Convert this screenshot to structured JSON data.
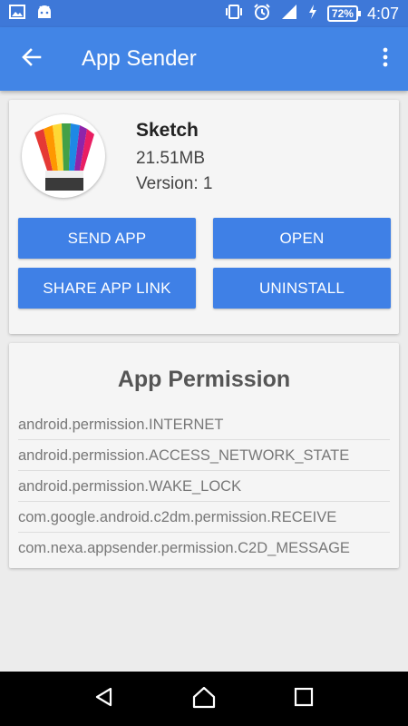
{
  "status_bar": {
    "battery_percent": "72%",
    "time": "4:07",
    "icons": [
      "image-icon",
      "android-icon",
      "vibrate-icon",
      "alarm-icon",
      "signal-icon",
      "charging-icon",
      "battery-icon"
    ]
  },
  "app_bar": {
    "title": "App Sender",
    "back_icon": "arrow-left-icon",
    "menu_icon": "more-vert-icon"
  },
  "app": {
    "name": "Sketch",
    "size": "21.51MB",
    "version": "Version: 1"
  },
  "actions": {
    "send": "SEND APP",
    "open": "OPEN",
    "share": "SHARE APP LINK",
    "uninstall": "UNINSTALL"
  },
  "permissions": {
    "title": "App Permission",
    "items": [
      "android.permission.INTERNET",
      "android.permission.ACCESS_NETWORK_STATE",
      "android.permission.WAKE_LOCK",
      "com.google.android.c2dm.permission.RECEIVE",
      "com.nexa.appsender.permission.C2D_MESSAGE"
    ]
  },
  "colors": {
    "status_bar": "#3e78d8",
    "app_bar": "#4285e6",
    "button": "#3f80e6"
  }
}
